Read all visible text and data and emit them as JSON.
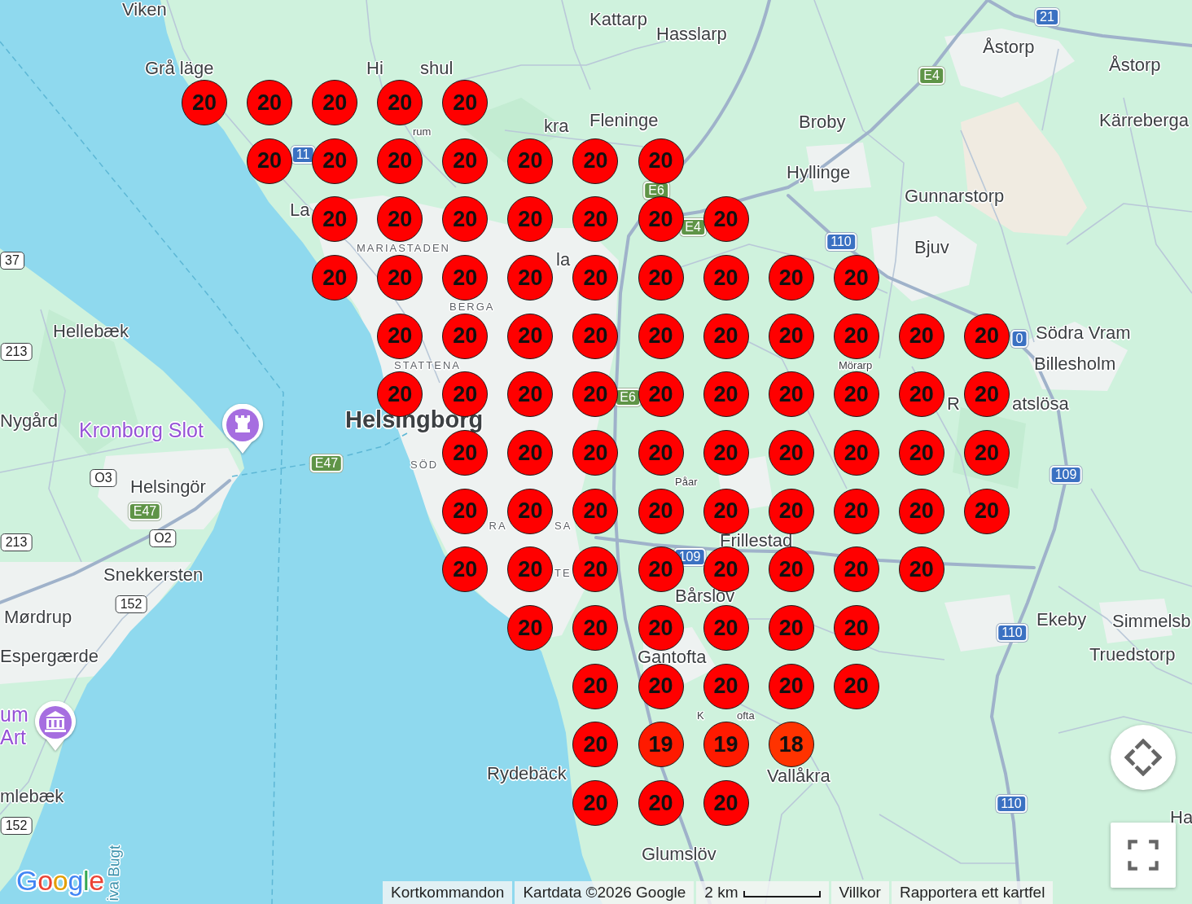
{
  "map": {
    "labels": [
      {
        "kind": "place",
        "text": "Viken"
      },
      {
        "kind": "place",
        "text": "Kattarp"
      },
      {
        "kind": "place",
        "text": "Hasslarp"
      },
      {
        "kind": "place",
        "text": "Åstorp"
      },
      {
        "kind": "place",
        "text": "Grå läge"
      },
      {
        "kind": "place",
        "text": "Hi"
      },
      {
        "kind": "place",
        "text": "shul"
      },
      {
        "kind": "place",
        "text": "Åstorp"
      },
      {
        "kind": "place",
        "text": "rum"
      },
      {
        "kind": "place",
        "text": "kra"
      },
      {
        "kind": "place",
        "text": "Fleninge"
      },
      {
        "kind": "place",
        "text": "Broby"
      },
      {
        "kind": "place",
        "text": "Kärreberga"
      },
      {
        "kind": "place",
        "text": "Hyllinge"
      },
      {
        "kind": "place",
        "text": "La"
      },
      {
        "kind": "place",
        "text": "Gunnarstorp"
      },
      {
        "kind": "district",
        "text": "MARIASTADEN"
      },
      {
        "kind": "place",
        "text": "la"
      },
      {
        "kind": "place",
        "text": "Bjuv"
      },
      {
        "kind": "district",
        "text": "BERGA"
      },
      {
        "kind": "place",
        "text": "Hellebæk"
      },
      {
        "kind": "place",
        "text": "Södra Vram"
      },
      {
        "kind": "district",
        "text": "STATTENA"
      },
      {
        "kind": "place",
        "text": "Mörarp"
      },
      {
        "kind": "place",
        "text": "Billesholm"
      },
      {
        "kind": "place",
        "text": "Nygård"
      },
      {
        "kind": "poi",
        "text": "Kronborg Slot"
      },
      {
        "kind": "city",
        "text": "Helsingborg"
      },
      {
        "kind": "place",
        "text": "R"
      },
      {
        "kind": "place",
        "text": "atslösa"
      },
      {
        "kind": "district",
        "text": "SÖD"
      },
      {
        "kind": "place",
        "text": "Helsingör"
      },
      {
        "kind": "place",
        "text": "Påar"
      },
      {
        "kind": "district",
        "text": "RA"
      },
      {
        "kind": "district",
        "text": "SA"
      },
      {
        "kind": "place",
        "text": "Frillestad"
      },
      {
        "kind": "place",
        "text": "Snekkersten"
      },
      {
        "kind": "district",
        "text": "TE"
      },
      {
        "kind": "place",
        "text": "Bårslöv"
      },
      {
        "kind": "place",
        "text": "Mørdrup"
      },
      {
        "kind": "place",
        "text": "Ekeby"
      },
      {
        "kind": "place",
        "text": "Simmelsb"
      },
      {
        "kind": "place",
        "text": "Espergærde"
      },
      {
        "kind": "place",
        "text": "Gantofta"
      },
      {
        "kind": "place",
        "text": "Truedstorp"
      },
      {
        "kind": "poi",
        "text": "um"
      },
      {
        "kind": "place",
        "text": "K"
      },
      {
        "kind": "place",
        "text": "ofta"
      },
      {
        "kind": "poi",
        "text": "Art"
      },
      {
        "kind": "place",
        "text": "Rydebäck"
      },
      {
        "kind": "place",
        "text": "Vallåkra"
      },
      {
        "kind": "place",
        "text": "mlebæk"
      },
      {
        "kind": "place",
        "text": "Ha"
      },
      {
        "kind": "water",
        "text": "iva Bugt"
      },
      {
        "kind": "place",
        "text": "Glumslöv"
      }
    ],
    "road_shields": [
      {
        "kind": "national",
        "text": "21"
      },
      {
        "kind": "european",
        "text": "E4"
      },
      {
        "kind": "national",
        "text": "11"
      },
      {
        "kind": "european",
        "text": "E6"
      },
      {
        "kind": "european",
        "text": "E4"
      },
      {
        "kind": "national",
        "text": "110"
      },
      {
        "kind": "regional",
        "text": "37"
      },
      {
        "kind": "regional",
        "text": "213"
      },
      {
        "kind": "national",
        "text": "0"
      },
      {
        "kind": "european",
        "text": "E6"
      },
      {
        "kind": "regional",
        "text": "O3"
      },
      {
        "kind": "european",
        "text": "E47"
      },
      {
        "kind": "national",
        "text": "109"
      },
      {
        "kind": "european",
        "text": "E47"
      },
      {
        "kind": "regional",
        "text": "213"
      },
      {
        "kind": "regional",
        "text": "O2"
      },
      {
        "kind": "national",
        "text": "109"
      },
      {
        "kind": "regional",
        "text": "152"
      },
      {
        "kind": "national",
        "text": "110"
      },
      {
        "kind": "national",
        "text": "110"
      },
      {
        "kind": "regional",
        "text": "152"
      }
    ],
    "marker_rows": [
      {
        "markers": [
          {
            "label": "20",
            "color": "#ff0000"
          },
          {
            "label": "20",
            "color": "#ff0000"
          },
          {
            "label": "20",
            "color": "#ff0000"
          },
          {
            "label": "20",
            "color": "#ff0000"
          },
          {
            "label": "20",
            "color": "#ff0000"
          }
        ]
      },
      {
        "markers": [
          {
            "label": "20",
            "color": "#ff0000"
          },
          {
            "label": "20",
            "color": "#ff0000"
          },
          {
            "label": "20",
            "color": "#ff0000"
          },
          {
            "label": "20",
            "color": "#ff0000"
          },
          {
            "label": "20",
            "color": "#ff0000"
          },
          {
            "label": "20",
            "color": "#ff0000"
          },
          {
            "label": "20",
            "color": "#ff0000"
          }
        ]
      },
      {
        "markers": [
          {
            "label": "20",
            "color": "#ff0000"
          },
          {
            "label": "20",
            "color": "#ff0000"
          },
          {
            "label": "20",
            "color": "#ff0000"
          },
          {
            "label": "20",
            "color": "#ff0000"
          },
          {
            "label": "20",
            "color": "#ff0000"
          },
          {
            "label": "20",
            "color": "#ff0000"
          },
          {
            "label": "20",
            "color": "#ff0000"
          }
        ]
      },
      {
        "markers": [
          {
            "label": "20",
            "color": "#ff0000"
          },
          {
            "label": "20",
            "color": "#ff0000"
          },
          {
            "label": "20",
            "color": "#ff0000"
          },
          {
            "label": "20",
            "color": "#ff0000"
          },
          {
            "label": "20",
            "color": "#ff0000"
          },
          {
            "label": "20",
            "color": "#ff0000"
          },
          {
            "label": "20",
            "color": "#ff0000"
          },
          {
            "label": "20",
            "color": "#ff0000"
          },
          {
            "label": "20",
            "color": "#ff0000"
          }
        ]
      },
      {
        "markers": [
          {
            "label": "20",
            "color": "#ff0000"
          },
          {
            "label": "20",
            "color": "#ff0000"
          },
          {
            "label": "20",
            "color": "#ff0000"
          },
          {
            "label": "20",
            "color": "#ff0000"
          },
          {
            "label": "20",
            "color": "#ff0000"
          },
          {
            "label": "20",
            "color": "#ff0000"
          },
          {
            "label": "20",
            "color": "#ff0000"
          },
          {
            "label": "20",
            "color": "#ff0000"
          },
          {
            "label": "20",
            "color": "#ff0000"
          },
          {
            "label": "20",
            "color": "#ff0000"
          }
        ]
      },
      {
        "markers": [
          {
            "label": "20",
            "color": "#ff0000"
          },
          {
            "label": "20",
            "color": "#ff0000"
          },
          {
            "label": "20",
            "color": "#ff0000"
          },
          {
            "label": "20",
            "color": "#ff0000"
          },
          {
            "label": "20",
            "color": "#ff0000"
          },
          {
            "label": "20",
            "color": "#ff0000"
          },
          {
            "label": "20",
            "color": "#ff0000"
          },
          {
            "label": "20",
            "color": "#ff0000"
          },
          {
            "label": "20",
            "color": "#ff0000"
          },
          {
            "label": "20",
            "color": "#ff0000"
          }
        ]
      },
      {
        "markers": [
          {
            "label": "20",
            "color": "#ff0000"
          },
          {
            "label": "20",
            "color": "#ff0000"
          },
          {
            "label": "20",
            "color": "#ff0000"
          },
          {
            "label": "20",
            "color": "#ff0000"
          },
          {
            "label": "20",
            "color": "#ff0000"
          },
          {
            "label": "20",
            "color": "#ff0000"
          },
          {
            "label": "20",
            "color": "#ff0000"
          },
          {
            "label": "20",
            "color": "#ff0000"
          },
          {
            "label": "20",
            "color": "#ff0000"
          }
        ]
      },
      {
        "markers": [
          {
            "label": "20",
            "color": "#ff0000"
          },
          {
            "label": "20",
            "color": "#ff0000"
          },
          {
            "label": "20",
            "color": "#ff0000"
          },
          {
            "label": "20",
            "color": "#ff0000"
          },
          {
            "label": "20",
            "color": "#ff0000"
          },
          {
            "label": "20",
            "color": "#ff0000"
          },
          {
            "label": "20",
            "color": "#ff0000"
          },
          {
            "label": "20",
            "color": "#ff0000"
          },
          {
            "label": "20",
            "color": "#ff0000"
          }
        ]
      },
      {
        "markers": [
          {
            "label": "20",
            "color": "#ff0000"
          },
          {
            "label": "20",
            "color": "#ff0000"
          },
          {
            "label": "20",
            "color": "#ff0000"
          },
          {
            "label": "20",
            "color": "#ff0000"
          },
          {
            "label": "20",
            "color": "#ff0000"
          },
          {
            "label": "20",
            "color": "#ff0000"
          },
          {
            "label": "20",
            "color": "#ff0000"
          },
          {
            "label": "20",
            "color": "#ff0000"
          }
        ]
      },
      {
        "markers": [
          {
            "label": "20",
            "color": "#ff0000"
          },
          {
            "label": "20",
            "color": "#ff0000"
          },
          {
            "label": "20",
            "color": "#ff0000"
          },
          {
            "label": "20",
            "color": "#ff0000"
          },
          {
            "label": "20",
            "color": "#ff0000"
          },
          {
            "label": "20",
            "color": "#ff0000"
          }
        ]
      },
      {
        "markers": [
          {
            "label": "20",
            "color": "#ff0000"
          },
          {
            "label": "20",
            "color": "#ff0000"
          },
          {
            "label": "20",
            "color": "#ff0000"
          },
          {
            "label": "20",
            "color": "#ff0000"
          },
          {
            "label": "20",
            "color": "#ff0000"
          }
        ]
      },
      {
        "markers": [
          {
            "label": "20",
            "color": "#ff0000"
          },
          {
            "label": "19",
            "color": "#ff1a00"
          },
          {
            "label": "19",
            "color": "#ff1a00"
          },
          {
            "label": "18",
            "color": "#ff3300"
          }
        ]
      },
      {
        "markers": [
          {
            "label": "20",
            "color": "#ff0000"
          },
          {
            "label": "20",
            "color": "#ff0000"
          },
          {
            "label": "20",
            "color": "#ff0000"
          }
        ]
      }
    ]
  },
  "logo": "Google",
  "attribution": {
    "shortcuts": "Kortkommandon",
    "map_data": "Kartdata ©2026 Google",
    "scale": "2 km",
    "terms": "Villkor",
    "report": "Rapportera ett kartfel"
  }
}
